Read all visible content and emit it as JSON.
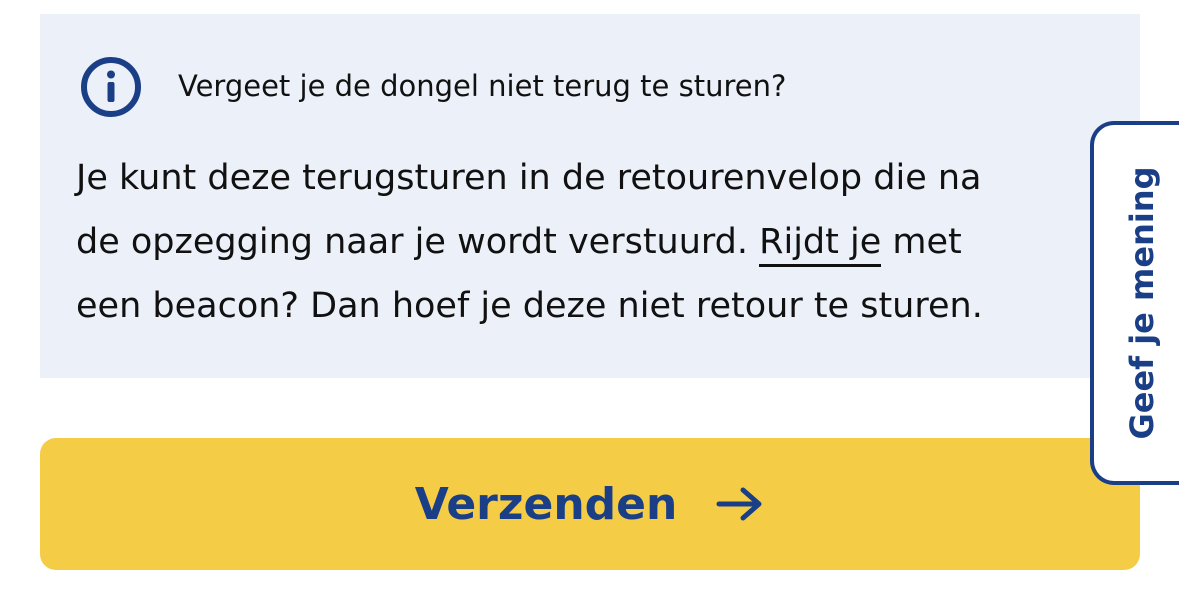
{
  "info_box": {
    "icon": "info-circle-icon",
    "title": "Vergeet je de dongel niet terug te sturen?",
    "body_line1": "Je kunt deze terugsturen in de retourenvelop die na",
    "body_line2_before": "de opzegging naar je wordt verstuurd. ",
    "body_link": "Rijdt je",
    "body_line2_after": " met",
    "body_line3": "een beacon? Dan hoef je deze niet retour te sturen."
  },
  "submit": {
    "label": "Verzenden",
    "icon": "arrow-right-icon"
  },
  "feedback_tab": {
    "label": "Geef je mening"
  },
  "colors": {
    "info_background": "#ecf0f8",
    "brand_blue": "#1b3f87",
    "button_yellow": "#f5cc46",
    "text": "#111111"
  }
}
